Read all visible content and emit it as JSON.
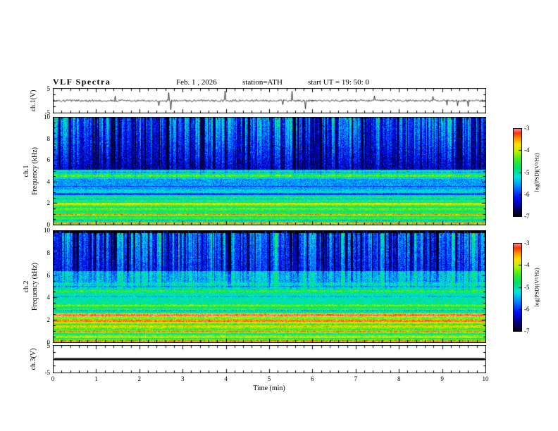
{
  "header": {
    "title": "VLF Spectra",
    "date": "Feb. 1 , 2026",
    "station": "station=ATH",
    "start_ut": "start UT =  19: 50: 0"
  },
  "xaxis": {
    "label": "Time (min)",
    "lim": [
      0,
      10
    ],
    "ticks": [
      0,
      1,
      2,
      3,
      4,
      5,
      6,
      7,
      8,
      9,
      10
    ]
  },
  "colorbar": {
    "label": "log(PSD)(V²/Hz)",
    "lim": [
      -7,
      -3
    ],
    "ticks": [
      -3,
      -4,
      -5,
      -6,
      -7
    ],
    "colormap": [
      [
        0.0,
        "#000000"
      ],
      [
        0.1,
        "#000080"
      ],
      [
        0.22,
        "#0010ff"
      ],
      [
        0.35,
        "#0090ff"
      ],
      [
        0.45,
        "#00e8e0"
      ],
      [
        0.55,
        "#00e070"
      ],
      [
        0.65,
        "#40f020"
      ],
      [
        0.75,
        "#c8f000"
      ],
      [
        0.82,
        "#ffe000"
      ],
      [
        0.89,
        "#ff9000"
      ],
      [
        0.95,
        "#ff3010"
      ],
      [
        1.0,
        "#ffa0b0"
      ]
    ]
  },
  "chart_data": [
    {
      "type": "line",
      "panel": "ch1_waveform",
      "ylabel": "ch.1(V)",
      "ylim": [
        -5,
        5
      ],
      "yticks": [
        5,
        -5
      ],
      "line_color": "#000000",
      "noise_amp": 0.45,
      "spike_prob": 0.018,
      "spike_amp": [
        1.5,
        4.5
      ],
      "seed": 4242,
      "description": "broadband noisy voltage trace centered near 0 V with impulsive sferic spikes reaching about +/-5 V"
    },
    {
      "type": "heatmap",
      "panel": "ch1_spectrogram",
      "ylabel_lines": [
        "ch.1",
        "Frequency (kHz)"
      ],
      "ylim": [
        0,
        10
      ],
      "yticks": [
        10,
        8,
        6,
        4,
        2,
        0
      ],
      "noise": 0.33,
      "seed": 12345,
      "bands": [
        [
          0.0,
          0.3,
          -4.35
        ],
        [
          0.3,
          0.6,
          -4.75
        ],
        [
          0.6,
          1.2,
          -4.55
        ],
        [
          1.2,
          2.3,
          -4.75
        ],
        [
          2.3,
          3.3,
          -5.15
        ],
        [
          3.3,
          4.3,
          -5.55
        ],
        [
          4.3,
          5.1,
          -5.15
        ],
        [
          5.1,
          10.01,
          -6.55
        ]
      ],
      "lines": [
        [
          0.15,
          0.08,
          0.7
        ],
        [
          0.45,
          0.06,
          -0.5
        ],
        [
          0.95,
          0.07,
          0.8
        ],
        [
          1.55,
          0.06,
          0.5
        ],
        [
          1.95,
          0.08,
          0.9
        ],
        [
          2.15,
          0.05,
          -0.6
        ],
        [
          2.55,
          0.06,
          0.6
        ],
        [
          2.9,
          0.1,
          -0.7
        ],
        [
          3.6,
          0.06,
          -0.5
        ],
        [
          4.55,
          0.1,
          0.7
        ],
        [
          4.9,
          0.05,
          -0.5
        ]
      ],
      "harmonics": {
        "df": 0.2,
        "fmax": 3.3,
        "boost": 0.3
      },
      "streaks": {
        "fmin": 4.2,
        "bright_density": 0.55,
        "bright_gain": 1.9,
        "dark_density": 0.18,
        "dark_gain": 1.2
      },
      "description": "0-10 kHz spectrogram: dark blue above 5 kHz crossed by dense vertical sferic streaks, bright cyan-green band near 4.5 kHz, green/yellow power-line harmonic stripes below 3 kHz"
    },
    {
      "type": "heatmap",
      "panel": "ch2_spectrogram",
      "ylabel_lines": [
        "ch.2",
        "Frequency (kHz)"
      ],
      "ylim": [
        0,
        10
      ],
      "yticks": [
        10,
        8,
        6,
        4,
        2,
        0
      ],
      "noise": 0.33,
      "seed": 67890,
      "bands": [
        [
          0.0,
          0.3,
          -4.25
        ],
        [
          0.3,
          0.8,
          -4.55
        ],
        [
          0.8,
          1.3,
          -4.35
        ],
        [
          1.3,
          2.3,
          -4.3
        ],
        [
          2.3,
          2.6,
          -4.05
        ],
        [
          2.6,
          3.4,
          -4.8
        ],
        [
          3.4,
          4.4,
          -5.0
        ],
        [
          4.4,
          5.4,
          -5.05
        ],
        [
          5.4,
          6.4,
          -5.35
        ],
        [
          6.4,
          9.8,
          -6.15
        ],
        [
          9.8,
          10.01,
          -7.2
        ]
      ],
      "lines": [
        [
          0.15,
          0.08,
          0.8
        ],
        [
          0.5,
          0.06,
          0.6
        ],
        [
          0.75,
          0.05,
          -0.5
        ],
        [
          1.0,
          0.06,
          0.7
        ],
        [
          1.5,
          0.06,
          0.6
        ],
        [
          1.95,
          0.09,
          1.0
        ],
        [
          2.45,
          0.1,
          1.0
        ],
        [
          2.85,
          0.06,
          -0.5
        ],
        [
          3.3,
          0.05,
          0.5
        ],
        [
          4.1,
          0.06,
          -0.4
        ],
        [
          4.6,
          0.08,
          0.5
        ],
        [
          5.0,
          0.05,
          -0.4
        ]
      ],
      "harmonics": {
        "df": 0.2,
        "fmax": 3.4,
        "boost": 0.3
      },
      "streaks": {
        "fmin": 4.6,
        "bright_density": 0.5,
        "bright_gain": 1.8,
        "dark_density": 0.3,
        "dark_gain": 1.6
      },
      "top_stripe": {
        "fmin": 9.8,
        "gap_prob": 0.12
      },
      "description": "0-10 kHz spectrogram: blue/green speckled above 6 kHz with bright and dark vertical streaks, black stripe segments along the 10 kHz edge, strong yellow-green harmonic bands below 2.6 kHz"
    },
    {
      "type": "line",
      "panel": "ch3_waveform",
      "ylabel": "ch.3(V)",
      "ylim": [
        -5,
        5
      ],
      "yticks": [
        5,
        -5
      ],
      "line_color": "#000000",
      "flat_value": 0,
      "line_width": 3,
      "description": "flat (zero) channel 3 voltage trace drawn as a thick black horizontal line"
    }
  ]
}
